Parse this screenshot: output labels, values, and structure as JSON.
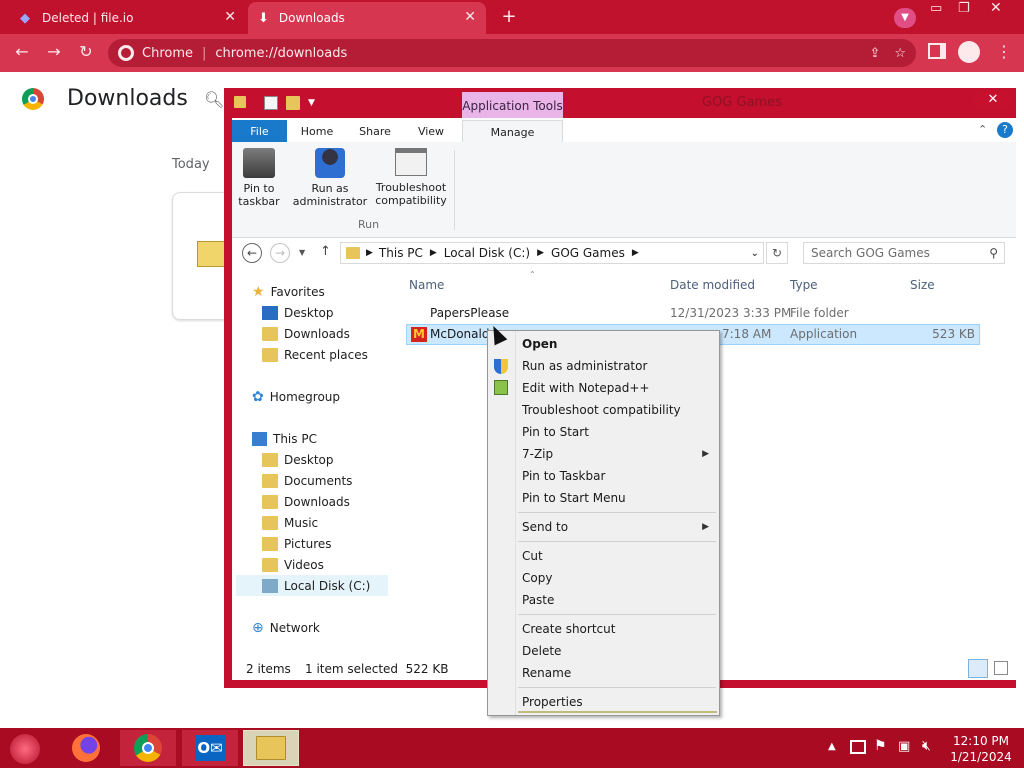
{
  "chrome": {
    "tabs": [
      {
        "title": "Deleted | file.io"
      },
      {
        "title": "Downloads"
      }
    ],
    "omnibox": {
      "site": "Chrome",
      "url": "chrome://downloads"
    }
  },
  "downloads_page": {
    "title": "Downloads",
    "section": "Today"
  },
  "explorer": {
    "title": "GOG Games",
    "contextual_tab_group": "Application Tools",
    "ribbon_tabs": [
      "File",
      "Home",
      "Share",
      "View",
      "Manage"
    ],
    "ribbon_buttons": [
      {
        "label": "Pin to taskbar"
      },
      {
        "label": "Run as administrator"
      },
      {
        "label": "Troubleshoot compatibility"
      }
    ],
    "ribbon_group": "Run",
    "address": [
      "This PC",
      "Local Disk (C:)",
      "GOG Games"
    ],
    "search_placeholder": "Search GOG Games",
    "nav": {
      "favorites": "Favorites",
      "favorites_items": [
        "Desktop",
        "Downloads",
        "Recent places"
      ],
      "homegroup": "Homegroup",
      "thispc": "This PC",
      "thispc_items": [
        "Desktop",
        "Documents",
        "Downloads",
        "Music",
        "Pictures",
        "Videos",
        "Local Disk (C:)"
      ],
      "network": "Network"
    },
    "columns": [
      "Name",
      "Date modified",
      "Type",
      "Size"
    ],
    "files": [
      {
        "name": "PapersPlease",
        "date": "12/31/2023 3:33 PM",
        "type": "File folder",
        "size": ""
      },
      {
        "name": "McDonalds",
        "date": "7:18 AM",
        "type": "Application",
        "size": "523 KB"
      }
    ],
    "status": {
      "count": "2 items",
      "selection": "1 item selected  522 KB"
    }
  },
  "context_menu": {
    "items": [
      "Open",
      "Run as administrator",
      "Edit with Notepad++",
      "Troubleshoot compatibility",
      "Pin to Start",
      "7-Zip",
      "Pin to Taskbar",
      "Pin to Start Menu",
      "Send to",
      "Cut",
      "Copy",
      "Paste",
      "Create shortcut",
      "Delete",
      "Rename",
      "Properties"
    ]
  },
  "taskbar": {
    "time": "12:10 PM",
    "date": "1/21/2024"
  },
  "colors": {
    "chrome_accent": "#c0122d",
    "window_frame": "#c40f2f",
    "taskbar": "#a90b22",
    "selection": "#cce8ff"
  }
}
